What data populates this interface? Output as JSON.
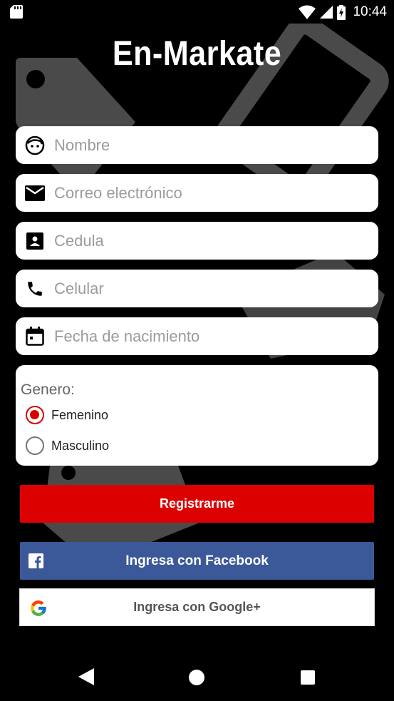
{
  "status_bar": {
    "time": "10:44",
    "icons": [
      "sd-card-icon",
      "wifi-icon",
      "signal-icon",
      "battery-charging-icon"
    ]
  },
  "app": {
    "title": "En-Markate"
  },
  "form": {
    "fields": [
      {
        "icon": "face-icon",
        "placeholder": "Nombre"
      },
      {
        "icon": "email-icon",
        "placeholder": "Correo electrónico"
      },
      {
        "icon": "id-card-icon",
        "placeholder": "Cedula"
      },
      {
        "icon": "phone-icon",
        "placeholder": "Celular"
      },
      {
        "icon": "calendar-icon",
        "placeholder": "Fecha de nacimiento"
      }
    ],
    "gender": {
      "label": "Genero:",
      "options": [
        {
          "label": "Femenino",
          "selected": true
        },
        {
          "label": "Masculino",
          "selected": false
        }
      ]
    }
  },
  "buttons": {
    "register": "Registrarme",
    "facebook": "Ingresa con Facebook",
    "google": "Ingresa con Google+"
  },
  "colors": {
    "accent": "#dd0000",
    "facebook": "#3b5998",
    "background": "#000000",
    "bg_shapes": "#4a4a4a"
  },
  "nav_bar": {
    "icons": [
      "back-icon",
      "home-icon",
      "recents-icon"
    ]
  }
}
